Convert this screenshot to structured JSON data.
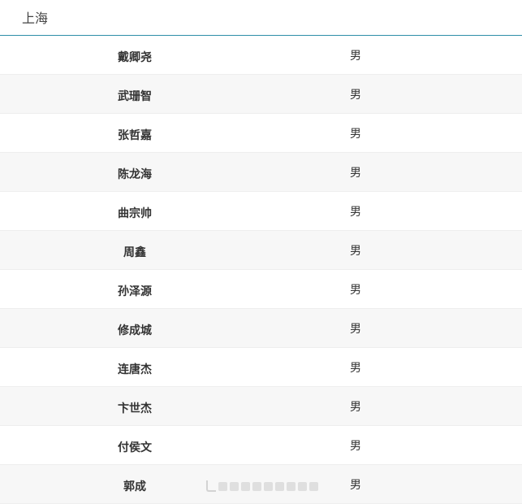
{
  "header": {
    "title": "上海"
  },
  "rows": [
    {
      "name": "戴卿尧",
      "gender": "男"
    },
    {
      "name": "武珊智",
      "gender": "男"
    },
    {
      "name": "张哲嘉",
      "gender": "男"
    },
    {
      "name": "陈龙海",
      "gender": "男"
    },
    {
      "name": "曲宗帅",
      "gender": "男"
    },
    {
      "name": "周鑫",
      "gender": "男"
    },
    {
      "name": "孙泽源",
      "gender": "男"
    },
    {
      "name": "修成城",
      "gender": "男"
    },
    {
      "name": "连唐杰",
      "gender": "男"
    },
    {
      "name": "卞世杰",
      "gender": "男"
    },
    {
      "name": "付侯文",
      "gender": "男"
    },
    {
      "name": "郭成",
      "gender": "男"
    }
  ],
  "colors": {
    "header_border": "#2f8fa8",
    "row_alt_background": "#f7f7f7",
    "row_border": "#eeeeee"
  }
}
